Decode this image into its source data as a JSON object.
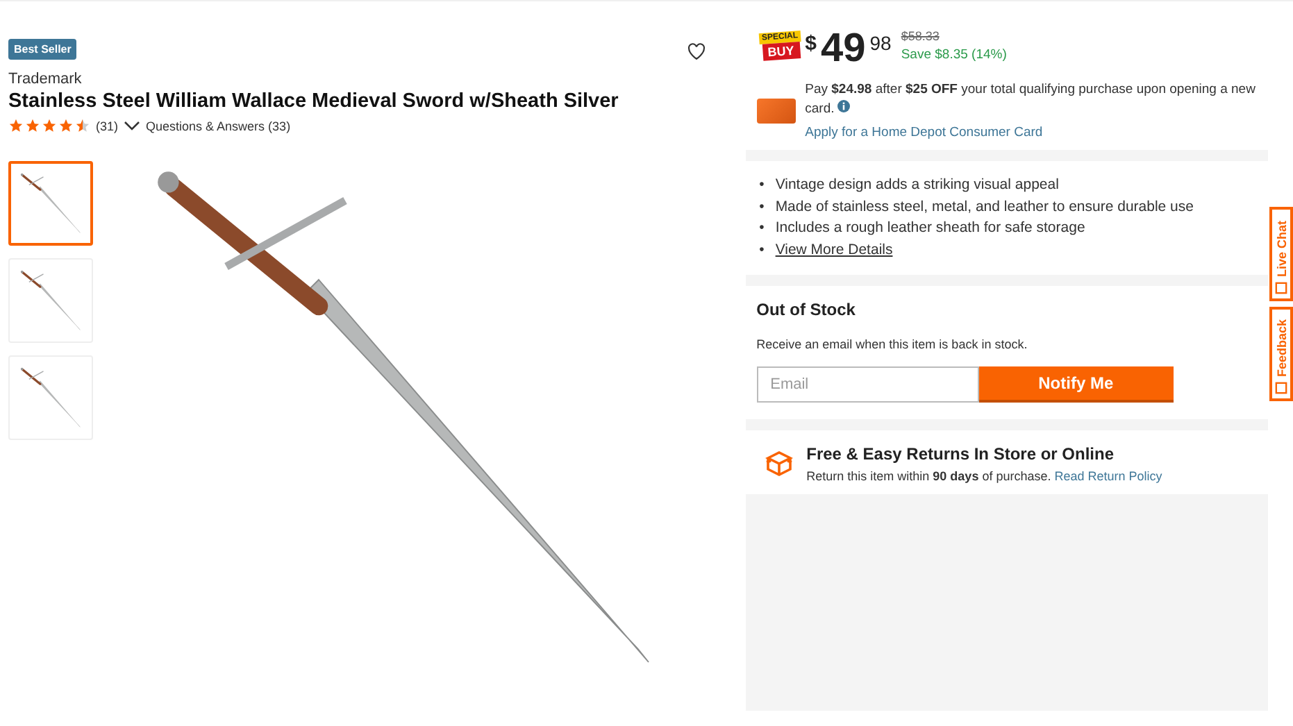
{
  "badge": "Best Seller",
  "brand": "Trademark",
  "title": "Stainless Steel William Wallace Medieval Sword w/Sheath Silver",
  "rating": {
    "stars": 4.5,
    "count": "(31)",
    "qa": "Questions & Answers (33)"
  },
  "thumbnails": [
    {
      "selected": true
    },
    {
      "selected": false
    },
    {
      "selected": false
    }
  ],
  "price": {
    "special_top": "SPECIAL",
    "special_bottom": "BUY",
    "currency": "$",
    "dollars": "49",
    "cents": "98",
    "was": "$58.33",
    "save": "Save $8.35 (14%)"
  },
  "card_offer": {
    "text": "Pay **$24.98** after **$25 OFF** your total qualifying purchase upon opening a new card.",
    "link": "Apply for a Home Depot Consumer Card"
  },
  "bullet": "•",
  "highlights": [
    {
      "text": "Vintage design adds a striking visual appeal",
      "kind": "text"
    },
    {
      "text": "Made of stainless steel, metal, and leather to ensure durable use",
      "kind": "text"
    },
    {
      "text": "Includes a rough leather sheath for safe storage",
      "kind": "text"
    },
    {
      "text": "View More Details",
      "kind": "link"
    }
  ],
  "stock": {
    "title": "Out of Stock",
    "message": "Receive an email when this item is back in stock.",
    "placeholder": "Email",
    "button": "Notify Me"
  },
  "returns": {
    "title": "Free & Easy Returns In Store or Online",
    "text": "Return this item within **90 days** of purchase.",
    "link": "Read Return Policy"
  },
  "side_tabs": [
    "Live Chat",
    "Feedback"
  ]
}
